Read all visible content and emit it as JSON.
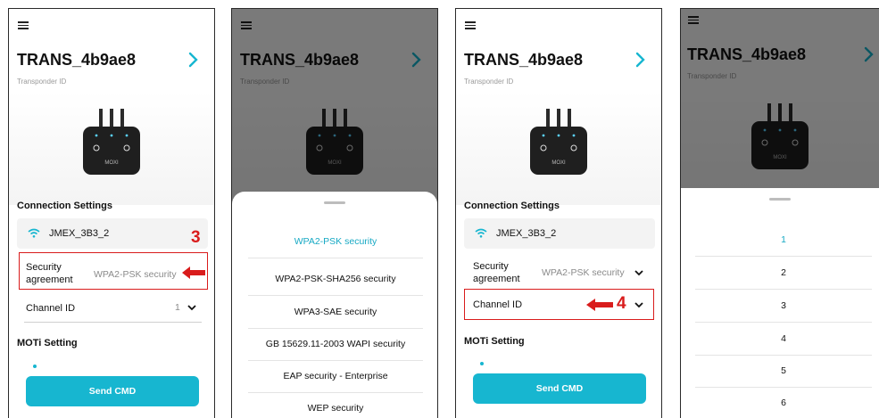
{
  "transponder": {
    "name": "TRANS_4b9ae8",
    "subtitle": "Transponder ID",
    "device_brand": "MOXI"
  },
  "connection": {
    "section_title": "Connection Settings",
    "wifi_name": "JMEX_3B3_2",
    "security_label_line1": "Security",
    "security_label_line2": "agreement",
    "security_value": "WPA2-PSK security",
    "channel_label": "Channel ID",
    "channel_value": "1"
  },
  "moti": {
    "section_title": "MOTi Setting"
  },
  "send_button_label": "Send CMD",
  "steps": {
    "security": "3",
    "channel": "4"
  },
  "security_options": [
    {
      "label": "WPA2-PSK security",
      "selected": true
    },
    {
      "label": "WPA2-PSK-SHA256 security",
      "selected": false
    },
    {
      "label": "WPA3-SAE security",
      "selected": false
    },
    {
      "label": "GB 15629.11-2003 WAPI security",
      "selected": false
    },
    {
      "label": "EAP security - Enterprise",
      "selected": false
    },
    {
      "label": "WEP security",
      "selected": false
    }
  ],
  "channel_options": [
    {
      "label": "1",
      "selected": true
    },
    {
      "label": "2",
      "selected": false
    },
    {
      "label": "3",
      "selected": false
    },
    {
      "label": "4",
      "selected": false
    },
    {
      "label": "5",
      "selected": false
    },
    {
      "label": "6",
      "selected": false
    }
  ],
  "colors": {
    "accent": "#17b6d0",
    "highlight": "#d91c1c"
  },
  "icons": [
    "hamburger-menu-icon",
    "chevron-right-icon",
    "wifi-icon",
    "chevron-down-icon",
    "red-arrow-left-icon",
    "drag-handle-icon"
  ]
}
